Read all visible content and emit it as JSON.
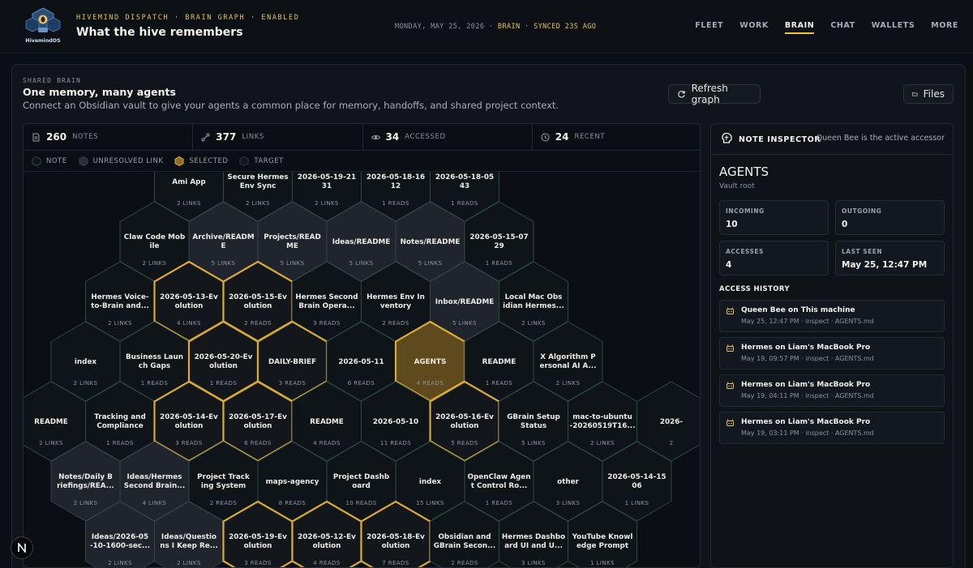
{
  "header": {
    "logo_text": "HivemindOS",
    "eyebrow": "HIVEMIND DISPATCH · BRAIN GRAPH · ENABLED",
    "title": "What the hive remembers",
    "date": "MONDAY, MAY 25, 2026",
    "sep1": " · ",
    "mode": "BRAIN",
    "sep2": " · ",
    "sync": "SYNCED 23S AGO",
    "nav": [
      "FLEET",
      "WORK",
      "BRAIN",
      "CHAT",
      "WALLETS",
      "MORE"
    ],
    "active_nav": "BRAIN"
  },
  "section": {
    "label": "SHARED BRAIN",
    "title": "One memory, many agents",
    "description": "Connect an Obsidian vault to give your agents a common place for memory, handoffs, and shared project context.",
    "refresh_label": "Refresh graph",
    "files_label": "Files"
  },
  "stats": [
    {
      "icon": "document-icon",
      "value": "260",
      "label": "NOTES"
    },
    {
      "icon": "link-icon",
      "value": "377",
      "label": "LINKS"
    },
    {
      "icon": "eye-icon",
      "value": "34",
      "label": "ACCESSED"
    },
    {
      "icon": "clock-icon",
      "value": "24",
      "label": "RECENT"
    }
  ],
  "legend": [
    {
      "label": "NOTE",
      "kind": "note"
    },
    {
      "label": "UNRESOLVED LINK",
      "kind": "unresolved"
    },
    {
      "label": "SELECTED",
      "kind": "selected"
    },
    {
      "label": "TARGET",
      "kind": "target"
    }
  ],
  "graph": {
    "rows": [
      {
        "offset": 2,
        "cells": [
          {
            "l1": "Ami App",
            "l2": "",
            "sub": "2 LINKS",
            "kind": "note"
          },
          {
            "l1": "Secure Hermes",
            "l2": "Env Sync",
            "sub": "2 LINKS",
            "kind": "note"
          },
          {
            "l1": "2026-05-19-21",
            "l2": "31",
            "sub": "2 LINKS",
            "kind": "note"
          },
          {
            "l1": "2026-05-18-16",
            "l2": "12",
            "sub": "1 READS",
            "kind": "note"
          },
          {
            "l1": "2026-05-18-05",
            "l2": "43",
            "sub": "1 READS",
            "kind": "note"
          }
        ]
      },
      {
        "offset": 1.5,
        "cells": [
          {
            "l1": "Claw Code Mob",
            "l2": "ile",
            "sub": "2 LINKS",
            "kind": "note"
          },
          {
            "l1": "Archive/READM",
            "l2": "E",
            "sub": "5 LINKS",
            "kind": "unresolved"
          },
          {
            "l1": "Projects/READ",
            "l2": "ME",
            "sub": "5 LINKS",
            "kind": "unresolved"
          },
          {
            "l1": "Ideas/README",
            "l2": "",
            "sub": "5 LINKS",
            "kind": "unresolved"
          },
          {
            "l1": "Notes/README",
            "l2": "",
            "sub": "5 LINKS",
            "kind": "unresolved"
          },
          {
            "l1": "2026-05-15-07",
            "l2": "29",
            "sub": "1 READS",
            "kind": "note"
          }
        ]
      },
      {
        "offset": 1,
        "cells": [
          {
            "l1": "Hermes Voice-",
            "l2": "to-Brain and...",
            "sub": "2 LINKS",
            "kind": "note"
          },
          {
            "l1": "2026-05-13-Ev",
            "l2": "olution",
            "sub": "4 LINKS",
            "kind": "selected"
          },
          {
            "l1": "2026-05-15-Ev",
            "l2": "olution",
            "sub": "2 READS",
            "kind": "selected"
          },
          {
            "l1": "Hermes Second",
            "l2": "Brain Opera...",
            "sub": "3 READS",
            "kind": "note"
          },
          {
            "l1": "Hermes Env In",
            "l2": "ventory",
            "sub": "2 READS",
            "kind": "note"
          },
          {
            "l1": "Inbox/README",
            "l2": "",
            "sub": "5 LINKS",
            "kind": "unresolved"
          },
          {
            "l1": "Local Mac Obs",
            "l2": "idian Hermes...",
            "sub": "2 LINKS",
            "kind": "note"
          }
        ]
      },
      {
        "offset": 0.5,
        "cells": [
          {
            "l1": "index",
            "l2": "",
            "sub": "2 LINKS",
            "kind": "note"
          },
          {
            "l1": "Business Laun",
            "l2": "ch Gaps",
            "sub": "1 READS",
            "kind": "note"
          },
          {
            "l1": "2026-05-20-Ev",
            "l2": "olution",
            "sub": "1 READS",
            "kind": "selected"
          },
          {
            "l1": "DAILY-BRIEF",
            "l2": "",
            "sub": "3 READS",
            "kind": "selected"
          },
          {
            "l1": "2026-05-11",
            "l2": "",
            "sub": "6 READS",
            "kind": "note"
          },
          {
            "l1": "AGENTS",
            "l2": "",
            "sub": "4 READS",
            "kind": "target"
          },
          {
            "l1": "README",
            "l2": "",
            "sub": "1 READS",
            "kind": "note"
          },
          {
            "l1": "X Algorithm P",
            "l2": "ersonal AI A...",
            "sub": "2 LINKS",
            "kind": "note"
          }
        ]
      },
      {
        "offset": 0,
        "cells": [
          {
            "l1": "README",
            "l2": "",
            "sub": "2 LINKS",
            "kind": "note"
          },
          {
            "l1": "Tracking and",
            "l2": "Compliance",
            "sub": "1 READS",
            "kind": "note"
          },
          {
            "l1": "2026-05-14-Ev",
            "l2": "olution",
            "sub": "3 READS",
            "kind": "selected"
          },
          {
            "l1": "2026-05-17-Ev",
            "l2": "olution",
            "sub": "6 READS",
            "kind": "selected"
          },
          {
            "l1": "README",
            "l2": "",
            "sub": "4 READS",
            "kind": "note"
          },
          {
            "l1": "2026-05-10",
            "l2": "",
            "sub": "11 READS",
            "kind": "note"
          },
          {
            "l1": "2026-05-16-Ev",
            "l2": "olution",
            "sub": "5 READS",
            "kind": "selected"
          },
          {
            "l1": "GBrain Setup",
            "l2": "Status",
            "sub": "5 LINKS",
            "kind": "note"
          },
          {
            "l1": "mac-to-ubuntu",
            "l2": "-20260519T16...",
            "sub": "2 LINKS",
            "kind": "note"
          },
          {
            "l1": "2026-",
            "l2": "",
            "sub": "2",
            "kind": "note"
          }
        ]
      },
      {
        "offset": 0.5,
        "cells": [
          {
            "l1": "Notes/Daily B",
            "l2": "riefings/REA...",
            "sub": "2 LINKS",
            "kind": "unresolved"
          },
          {
            "l1": "Ideas/Hermes",
            "l2": "Second Brain...",
            "sub": "4 LINKS",
            "kind": "unresolved"
          },
          {
            "l1": "Project Track",
            "l2": "ing System",
            "sub": "2 READS",
            "kind": "note"
          },
          {
            "l1": "maps-agency",
            "l2": "",
            "sub": "8 READS",
            "kind": "note"
          },
          {
            "l1": "Project Dashb",
            "l2": "oard",
            "sub": "10 READS",
            "kind": "note"
          },
          {
            "l1": "index",
            "l2": "",
            "sub": "15 LINKS",
            "kind": "note"
          },
          {
            "l1": "OpenClaw Agen",
            "l2": "t Control Ro...",
            "sub": "1 READS",
            "kind": "note"
          },
          {
            "l1": "other",
            "l2": "",
            "sub": "3 LINKS",
            "kind": "note"
          },
          {
            "l1": "2026-05-14-15",
            "l2": "06",
            "sub": "1 LINKS",
            "kind": "note"
          }
        ]
      },
      {
        "offset": 1,
        "cells": [
          {
            "l1": "Ideas/2026-05",
            "l2": "-10-1600-sec...",
            "sub": "2 LINKS",
            "kind": "unresolved"
          },
          {
            "l1": "Ideas/Questio",
            "l2": "ns I Keep Re...",
            "sub": "2 LINKS",
            "kind": "unresolved"
          },
          {
            "l1": "2026-05-19-Ev",
            "l2": "olution",
            "sub": "3 READS",
            "kind": "selected"
          },
          {
            "l1": "2026-05-12-Ev",
            "l2": "olution",
            "sub": "4 READS",
            "kind": "selected"
          },
          {
            "l1": "2026-05-18-Ev",
            "l2": "olution",
            "sub": "7 READS",
            "kind": "selected"
          },
          {
            "l1": "Obsidian and",
            "l2": "GBrain Secon...",
            "sub": "2 READS",
            "kind": "note"
          },
          {
            "l1": "Hermes Dashbo",
            "l2": "ard UI and U...",
            "sub": "3 LINKS",
            "kind": "note"
          },
          {
            "l1": "YouTube Knowl",
            "l2": "edge Prompt",
            "sub": "1 LINKS",
            "kind": "note"
          }
        ]
      }
    ]
  },
  "inspector": {
    "title": "NOTE INSPECTOR",
    "subtitle": "Queen Bee is the active accessor",
    "note_name": "AGENTS",
    "note_path": "Vault root",
    "metrics": [
      {
        "label": "INCOMING",
        "value": "10"
      },
      {
        "label": "OUTGOING",
        "value": "0"
      },
      {
        "label": "ACCESSES",
        "value": "4"
      },
      {
        "label": "LAST SEEN",
        "value": "May 25, 12:47 PM"
      }
    ],
    "history_title": "ACCESS HISTORY",
    "history": [
      {
        "who": "Queen Bee on This machine",
        "meta": "May 25, 12:47 PM · inspect · AGENTS.md"
      },
      {
        "who": "Hermes on Liam's MacBook Pro",
        "meta": "May 19, 09:57 PM · inspect · AGENTS.md"
      },
      {
        "who": "Hermes on Liam's MacBook Pro",
        "meta": "May 19, 04:11 PM · inspect · AGENTS.md"
      },
      {
        "who": "Hermes on Liam's MacBook Pro",
        "meta": "May 19, 03:11 PM · inspect · AGENTS.md"
      }
    ]
  },
  "footer": {
    "badge": "N"
  },
  "colors": {
    "accent": "#e6c25a",
    "note_fill": "#0f1419",
    "note_stroke": "#2c4a46",
    "unresolved_fill": "#20252d",
    "selected_fill": "#13171c",
    "selected_stroke": "#d8aa3a",
    "target_fill": "#5e4a1d",
    "target_stroke": "#d8aa3a",
    "background": "#0c0f14"
  }
}
